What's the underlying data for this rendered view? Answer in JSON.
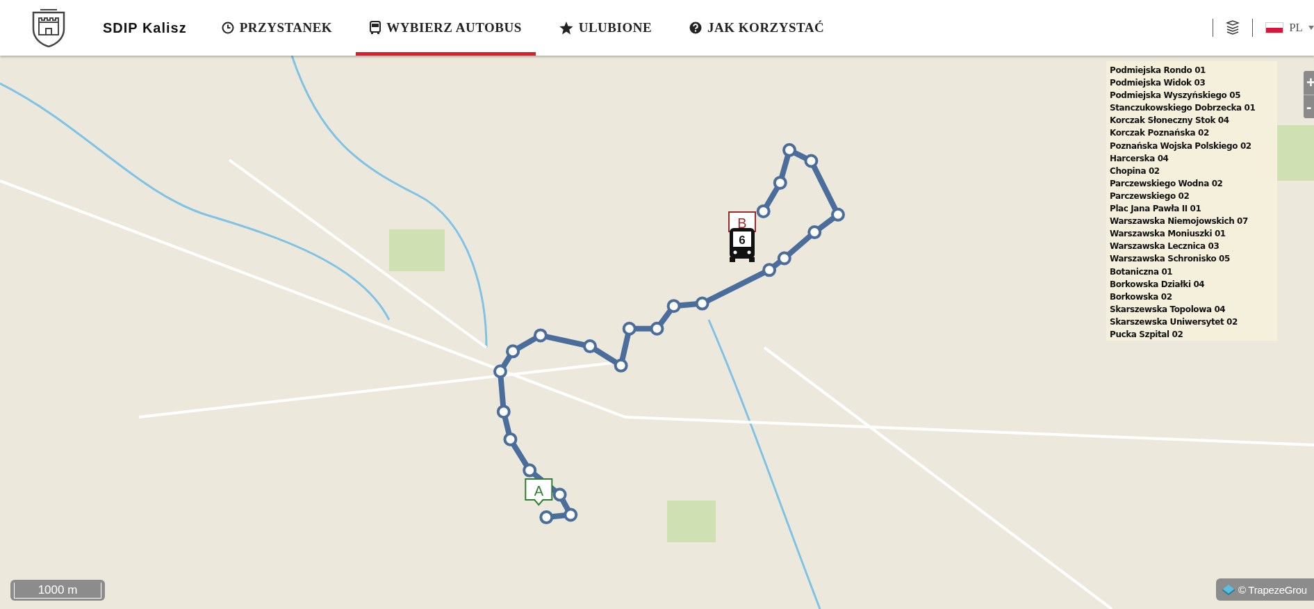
{
  "header": {
    "brand": "SDIP Kalisz",
    "tabs": [
      {
        "label": "PRZYSTANEK",
        "selected": false
      },
      {
        "label": "WYBIERZ AUTOBUS",
        "selected": true
      },
      {
        "label": "ULUBIONE",
        "selected": false
      },
      {
        "label": "JAK KORZYSTAĆ",
        "selected": false
      }
    ],
    "language": "PL"
  },
  "map": {
    "start_marker": "A",
    "end_marker": "B",
    "bus_line": "6",
    "zoom_in": "+",
    "zoom_out": "-",
    "scale": "1000 m",
    "attribution": "© TrapezeGrou",
    "stops": [
      "Podmiejska Rondo 01",
      "Podmiejska Widok 03",
      "Podmiejska Wyszyńskiego 05",
      "Stanczukowskiego Dobrzecka 01",
      "Korczak Słoneczny Stok 04",
      "Korczak Poznańska 02",
      "Poznańska Wojska Polskiego 02",
      "Harcerska 04",
      "Chopina 02",
      "Parczewskiego Wodna 02",
      "Parczewskiego 02",
      "Plac Jana Pawła II 01",
      "Warszawska Niemojowskich 07",
      "Warszawska Moniuszki 01",
      "Warszawska Lecznica 03",
      "Warszawska Schronisko 05",
      "Botaniczna 01",
      "Borkowska Działki 04",
      "Borkowska 02",
      "Skarszewska Topolowa 04",
      "Skarszewska Uniwersytet 02",
      "Pucka Szpital 02"
    ]
  }
}
